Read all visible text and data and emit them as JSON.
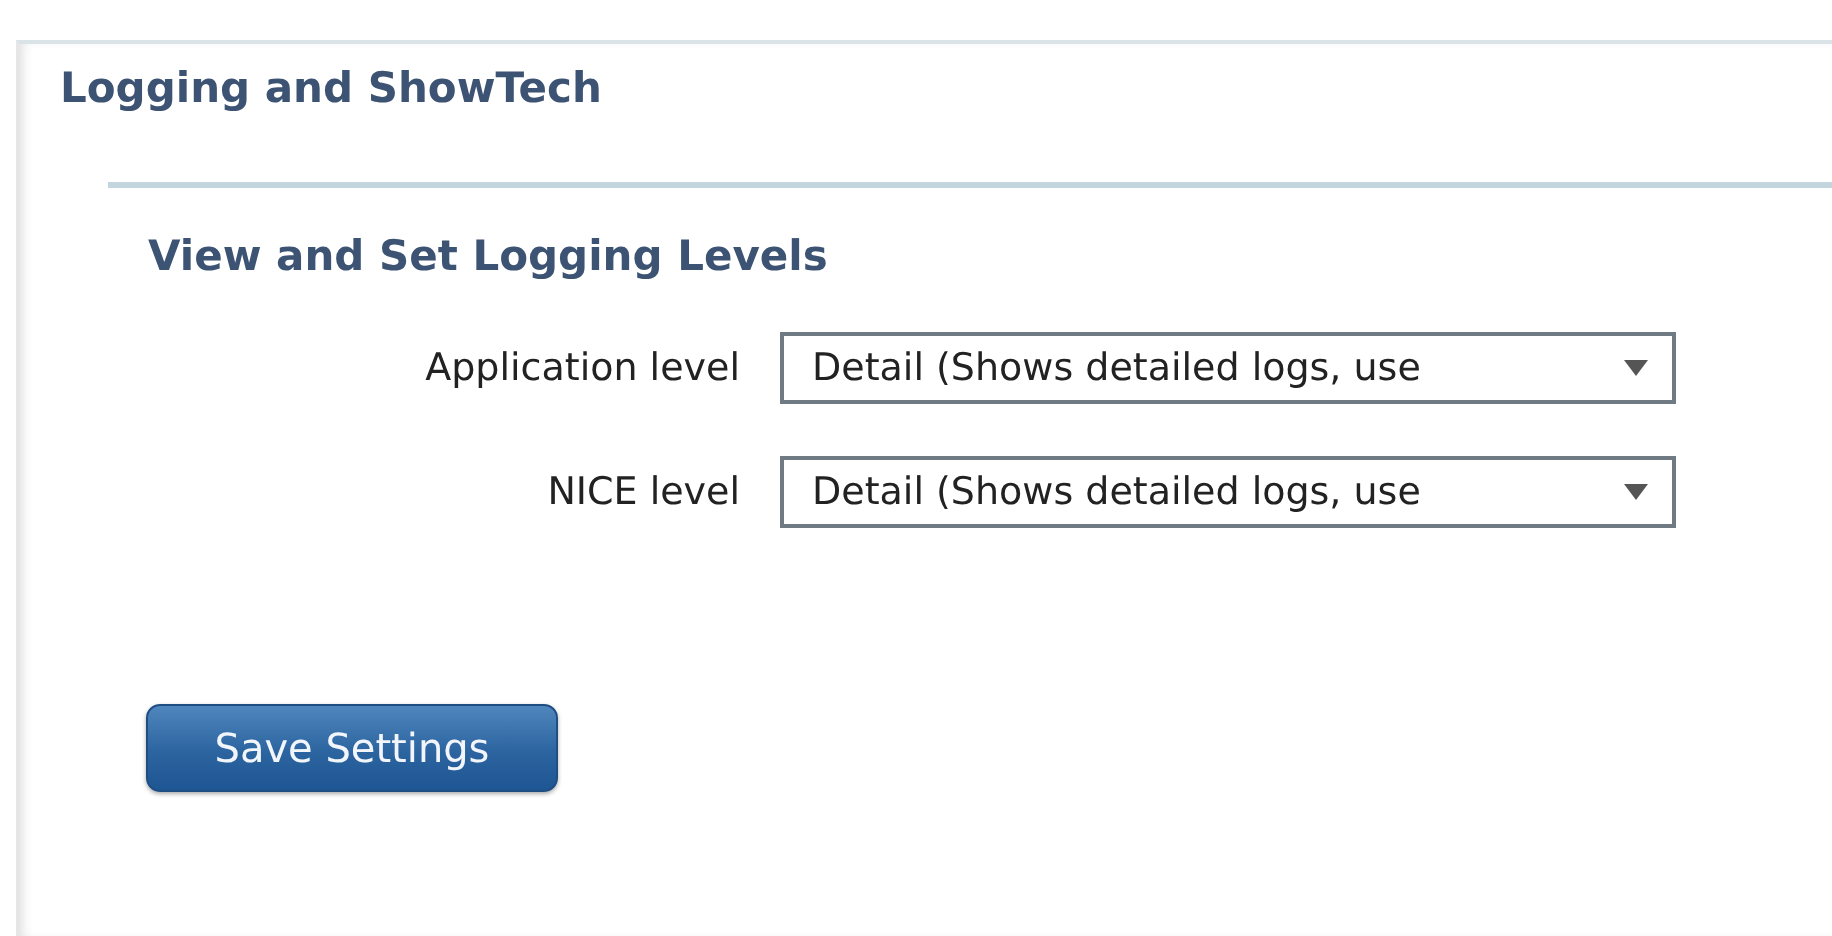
{
  "panel": {
    "title": "Logging and ShowTech"
  },
  "section": {
    "title": "View and Set Logging Levels"
  },
  "fields": [
    {
      "label": "Application level",
      "value": "Detail (Shows detailed logs, use"
    },
    {
      "label": "NICE level",
      "value": "Detail (Shows detailed logs, use"
    }
  ],
  "buttons": [
    "Save Settings"
  ]
}
